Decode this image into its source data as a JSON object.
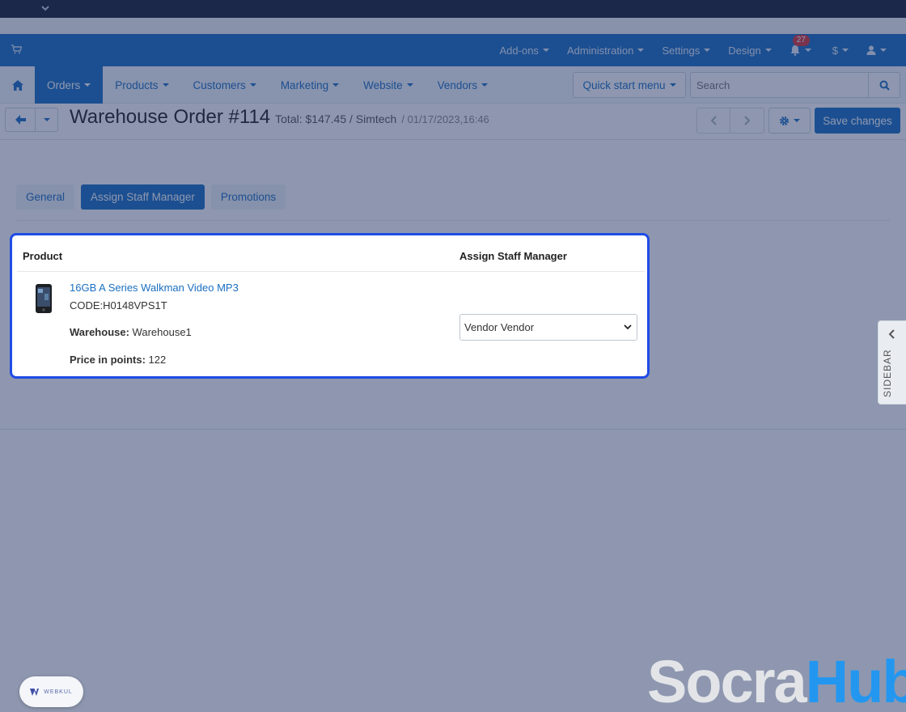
{
  "admin_bar": {
    "menu": [
      "Add-ons",
      "Administration",
      "Settings",
      "Design"
    ],
    "notifications_count": "27",
    "currency": "$"
  },
  "nav": {
    "tabs": [
      {
        "label": "Orders",
        "active": true
      },
      {
        "label": "Products",
        "active": false
      },
      {
        "label": "Customers",
        "active": false
      },
      {
        "label": "Marketing",
        "active": false
      },
      {
        "label": "Website",
        "active": false
      },
      {
        "label": "Vendors",
        "active": false
      }
    ],
    "quick_start": "Quick start menu",
    "search_placeholder": "Search"
  },
  "title_bar": {
    "title": "Warehouse Order #114",
    "total": "Total: $147.45 / Simtech",
    "date": "/ 01/17/2023,16:46",
    "save_label": "Save changes"
  },
  "tabs": [
    {
      "label": "General",
      "active": false
    },
    {
      "label": "Assign Staff Manager",
      "active": true
    },
    {
      "label": "Promotions",
      "active": false
    }
  ],
  "table": {
    "col_product": "Product",
    "col_assign": "Assign Staff Manager",
    "product_name": "16GB A Series Walkman Video MP3",
    "product_code": "CODE:H0148VPS1T",
    "warehouse_label": "Warehouse:",
    "warehouse_value": "Warehouse1",
    "points_label": "Price in points:",
    "points_value": "122",
    "assign_value": "Vendor Vendor"
  },
  "sidebar_label": "SIDEBAR",
  "webkul_label": "WEBKUL",
  "brand": {
    "part1": "Socra",
    "part2": "Hub"
  },
  "colors": {
    "primary": "#1a6fc2",
    "highlight": "#1f4ce6",
    "badge": "#d9373b"
  }
}
